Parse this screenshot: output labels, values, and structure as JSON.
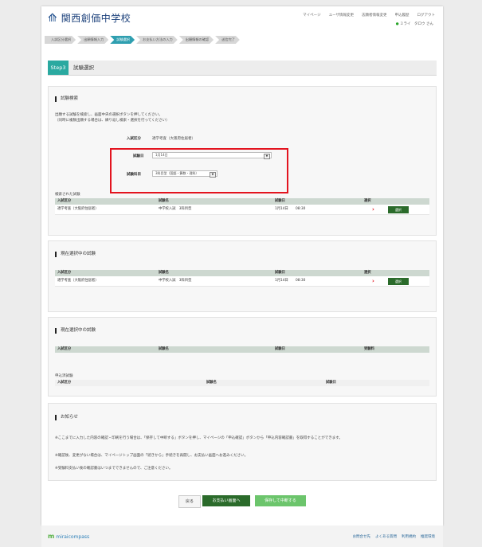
{
  "header": {
    "school_name": "関西創価中学校",
    "logo_mark": "⟰",
    "nav": [
      "マイページ",
      "ユーザ情報変更",
      "志願者情報変更",
      "申込履歴",
      "ログアウト"
    ],
    "user_name": "ミライ　タロウ さん"
  },
  "steps": [
    "入試区分選択",
    "出願情報入力",
    "試験選択",
    "お支払い方法の入力",
    "出願情報の確認",
    "送信完了"
  ],
  "active_step_index": 2,
  "step_title": {
    "badge": "Step3",
    "title": "試験選択"
  },
  "search_panel": {
    "title": "試験検索",
    "description_1": "出願する試験を検索し、画面中央の選択ボタンを押してください。",
    "description_2": "（同時に複数出願する場合は、繰り返し検索・選択を行ってください）",
    "division_label": "入試区分",
    "division_value": "適学考査（大阪府住居者）",
    "date_label": "試験日",
    "date_value": "1月14日",
    "exam_label": "試験科目",
    "exam_value": "3科目型（国語・算数・理科）",
    "result_label": "検索された試験"
  },
  "table_headers": {
    "division": "入試区分",
    "exam": "試験名",
    "date": "試験日",
    "select": "選択",
    "fee": "受験料"
  },
  "search_result": {
    "division": "適学考査（大阪府住居者）",
    "exam": "中学校入試　3科目型",
    "date": "1月14日",
    "time": "08:30",
    "button": "選択"
  },
  "selecting_panel": {
    "title": "現在選択中の試験",
    "row": {
      "division": "適学考査（大阪府住居者）",
      "exam": "中学校入試　3科目型",
      "date": "1月14日",
      "time": "08:30",
      "button": "選択"
    }
  },
  "selected_panel": {
    "title": "現在選択中の試験",
    "applied_label": "申込済試験"
  },
  "notice": {
    "title": "お知らせ",
    "line1": "※ここまでに入力した内容の確認・印刷を行う場合は、「保存して中断する」ボタンを押し、マイページの「申込確認」ボタンから「申込内容確認書」を取得することができます。",
    "line2": "※確認後、変更がない場合は、マイページトップ画面の「続きから」手続きを再開し、お支払い画面へお進みください。",
    "line3": "※受験料支払い後の確認書はいつまでできませんので、ご注意ください。"
  },
  "buttons": {
    "back": "戻る",
    "pay": "お支払い画面へ",
    "save": "保存して中断する"
  },
  "footer": {
    "logo_m": "m",
    "logo_text": "miraicompass",
    "links": [
      "お問合せ先",
      "よくある質問",
      "利用規約",
      "推奨環境"
    ]
  },
  "colors": {
    "accent_teal": "#2aa9a0",
    "highlight_red": "#e3141f",
    "button_green": "#2b6b2b",
    "button_light_green": "#6cc56c"
  }
}
